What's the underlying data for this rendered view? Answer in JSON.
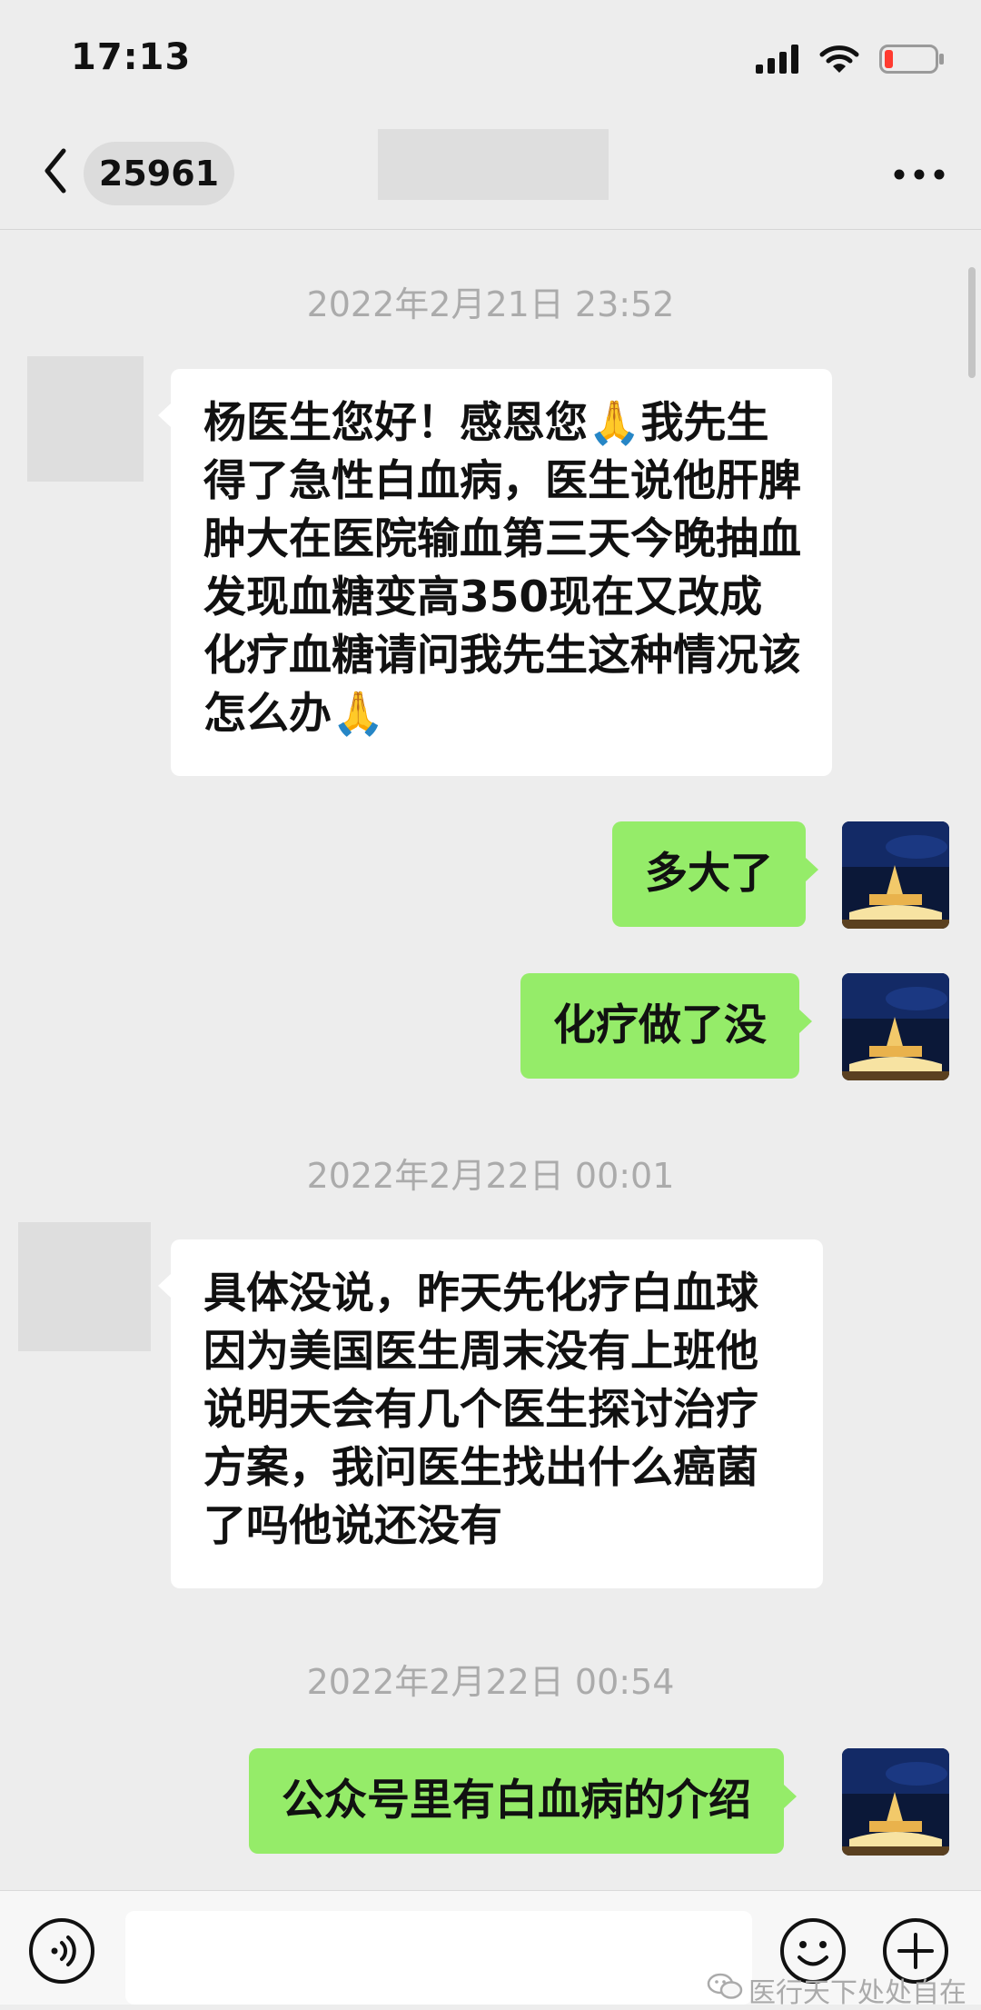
{
  "status_bar": {
    "time": "17:13",
    "icons": [
      "signal-icon",
      "wifi-icon",
      "battery-low-icon"
    ],
    "battery_color": "#ff3b30"
  },
  "nav": {
    "back_icon": "chevron-left-icon",
    "unread_count": "25961",
    "more_icon": "more-horizontal-icon"
  },
  "messages": [
    {
      "type": "timestamp",
      "text": "2022年2月21日 23:52"
    },
    {
      "type": "incoming",
      "text": "杨医生您好！感恩您🙏我先生得了急性白血病，医生说他肝脾肿大在医院输血第三天今晚抽血发现血糖变高350现在又改成化疗血糖请问我先生这种情况该怎么办🙏"
    },
    {
      "type": "outgoing",
      "text": "多大了"
    },
    {
      "type": "outgoing",
      "text": "化疗做了没"
    },
    {
      "type": "timestamp",
      "text": "2022年2月22日 00:01"
    },
    {
      "type": "incoming",
      "text": "具体没说，昨天先化疗白血球因为美国医生周末没有上班他说明天会有几个医生探讨治疗方案，我问医生找出什么癌菌了吗他说还没有"
    },
    {
      "type": "timestamp",
      "text": "2022年2月22日 00:54"
    },
    {
      "type": "outgoing",
      "text": "公众号里有白血病的介绍"
    }
  ],
  "input_bar": {
    "voice_icon": "voice-icon",
    "input_value": "",
    "emoji_icon": "emoji-icon",
    "plus_icon": "plus-icon"
  },
  "watermark": {
    "text": "医行天下处处自在",
    "icon": "wechat-icon"
  },
  "colors": {
    "background": "#ededed",
    "outgoing_bubble": "#95ec69",
    "incoming_bubble": "#ffffff",
    "timestamp": "#ababab"
  }
}
